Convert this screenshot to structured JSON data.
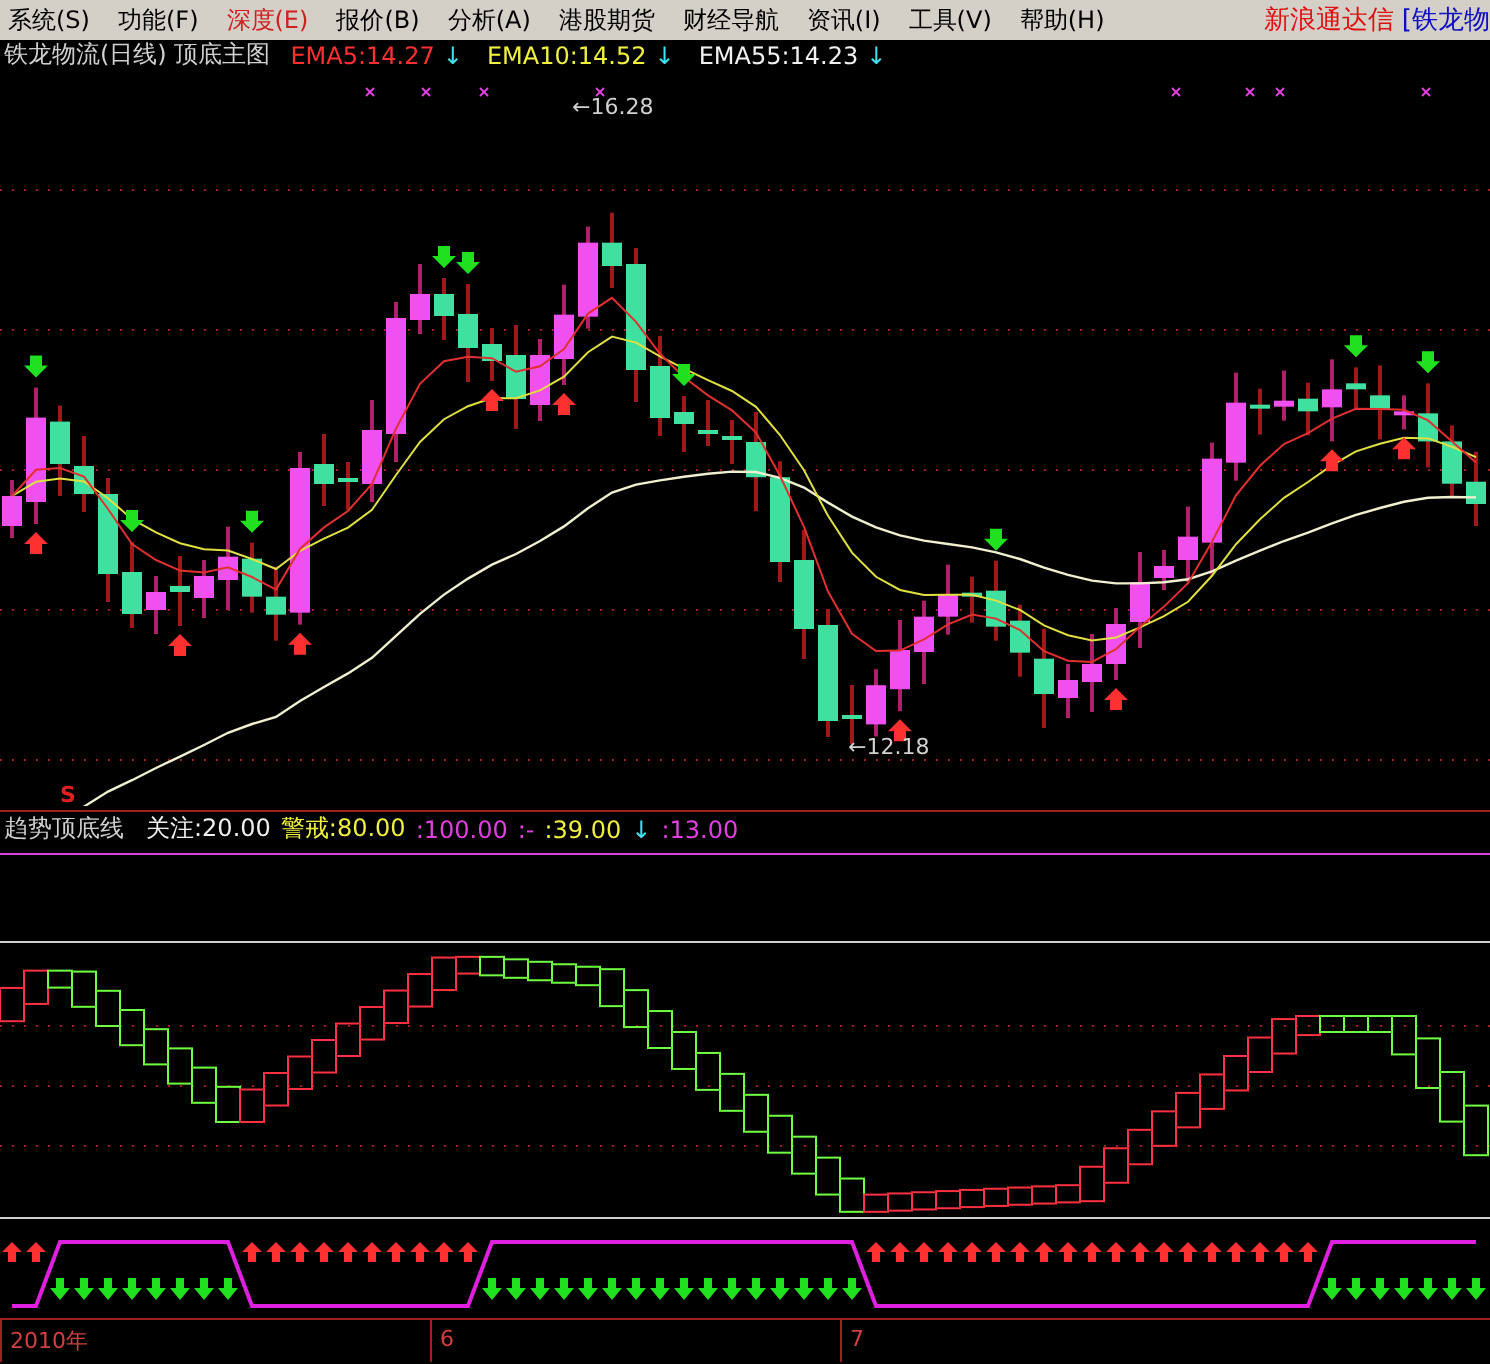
{
  "menu": [
    {
      "label": "系统(S)"
    },
    {
      "label": "功能(F)"
    },
    {
      "label": "深度(E)",
      "selected": true
    },
    {
      "label": "报价(B)"
    },
    {
      "label": "分析(A)"
    },
    {
      "label": "港股期货"
    },
    {
      "label": "财经导航"
    },
    {
      "label": "资讯(I)"
    },
    {
      "label": "工具(V)"
    },
    {
      "label": "帮助(H)"
    }
  ],
  "brand": "新浪通达信",
  "stock_tab": "[铁龙物",
  "main_chart": {
    "title": "铁龙物流(日线) 顶底主图",
    "indicators": [
      {
        "label": "EMA5:14.27",
        "color": "#ff3030",
        "trend": "↓"
      },
      {
        "label": "EMA10:14.52",
        "color": "#f0f040",
        "trend": "↓"
      },
      {
        "label": "EMA55:14.23",
        "color": "#f0f0f0",
        "trend": "↓"
      }
    ],
    "high_label": "←16.28",
    "low_label": "←12.18",
    "signal_mark": "S"
  },
  "indicator_panel": {
    "title": "趋势顶底线",
    "values": [
      {
        "label": "关注:20.00",
        "color": "#f0f0f0"
      },
      {
        "label": "警戒:80.00",
        "color": "#f0f040"
      },
      {
        "label": ":100.00",
        "color": "#e040e0"
      },
      {
        "label": ":-",
        "color": "#e040e0"
      },
      {
        "label": ":39.00",
        "color": "#f0f040"
      },
      {
        "label": "↓",
        "color": "#40e0f0"
      },
      {
        "label": ":13.00",
        "color": "#e040e0"
      }
    ]
  },
  "time_axis": [
    "2010年",
    "6",
    "7"
  ]
}
